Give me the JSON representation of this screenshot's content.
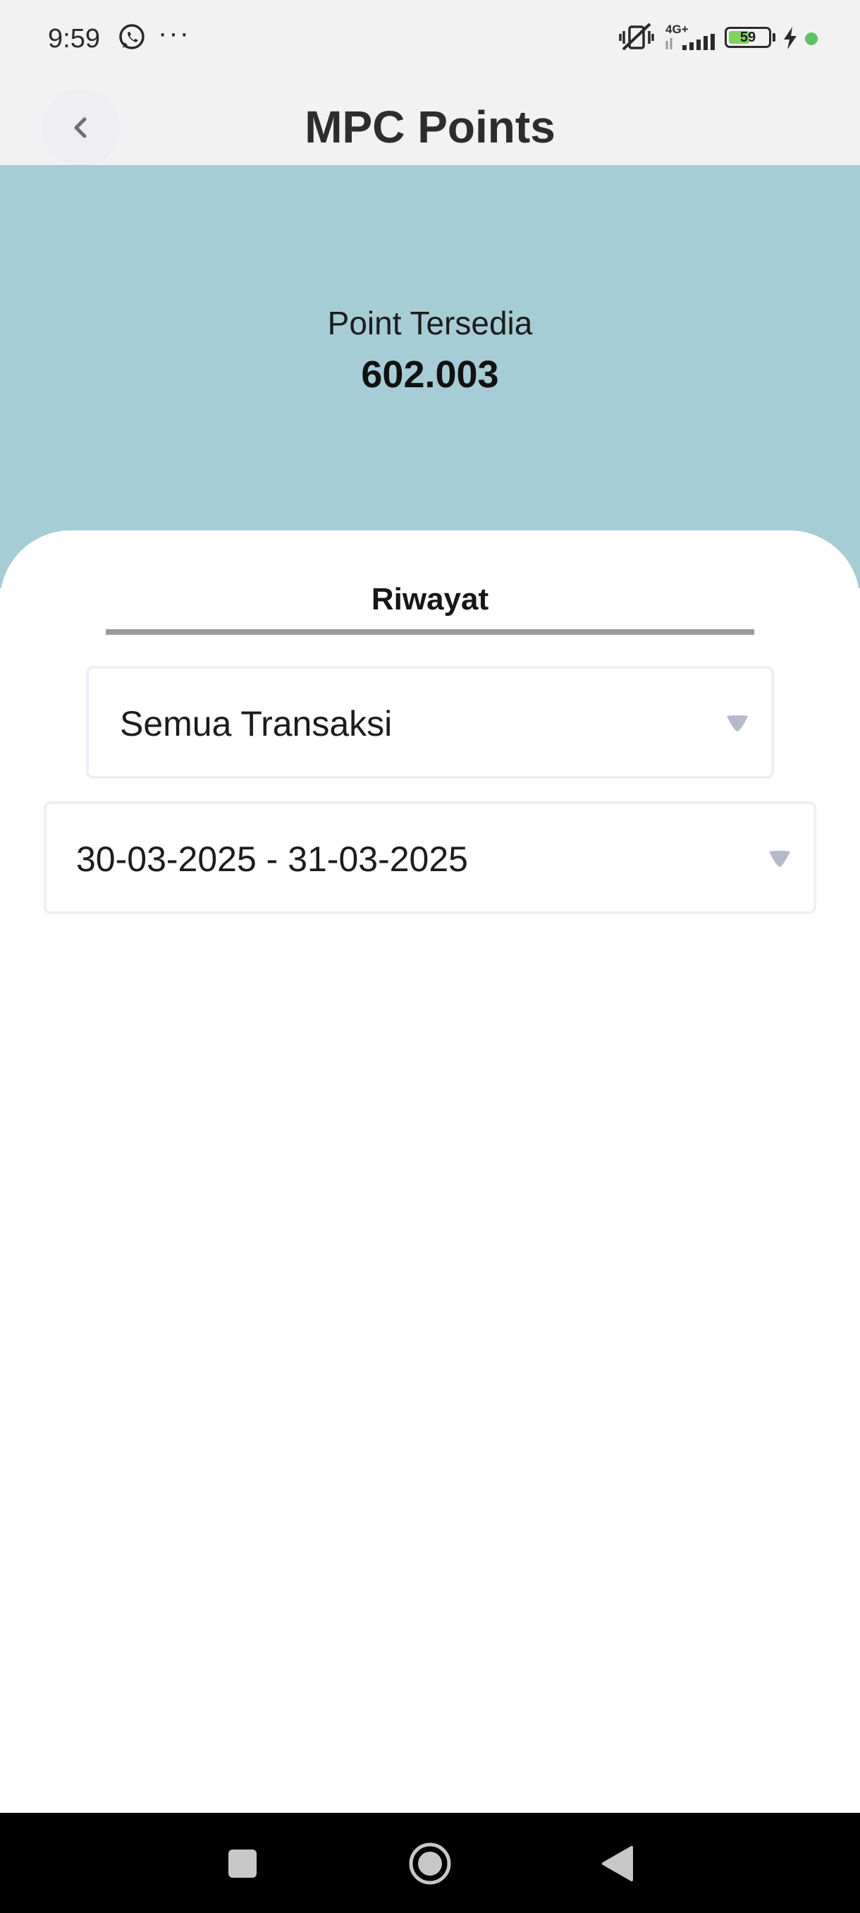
{
  "status_bar": {
    "time": "9:59",
    "overflow": "···",
    "network": "4G+",
    "battery": "59",
    "battery_level_percent": 59,
    "icons": [
      "whatsapp-icon",
      "vibrate-muted-icon",
      "signal-icon",
      "battery-icon",
      "charging-icon"
    ]
  },
  "header": {
    "title": "MPC Points",
    "back_icon": "chevron-left-icon"
  },
  "points": {
    "label": "Point Tersedia",
    "value": "602.003"
  },
  "history": {
    "tab_label": "Riwayat",
    "transaction_filter": {
      "selected": "Semua Transaksi",
      "icon": "caret-down-icon"
    },
    "date_filter": {
      "selected": "30-03-2025 - 31-03-2025",
      "icon": "caret-down-icon"
    }
  },
  "nav_bar": {
    "icons": [
      "recents-icon",
      "home-icon",
      "back-icon"
    ]
  },
  "colors": {
    "points_panel": "#a6cdd5",
    "header_background": "#f2f2f2",
    "tab_underline": "#9b9b9b",
    "caret": "#b4bac9",
    "battery_fill": "#7dd35d"
  }
}
